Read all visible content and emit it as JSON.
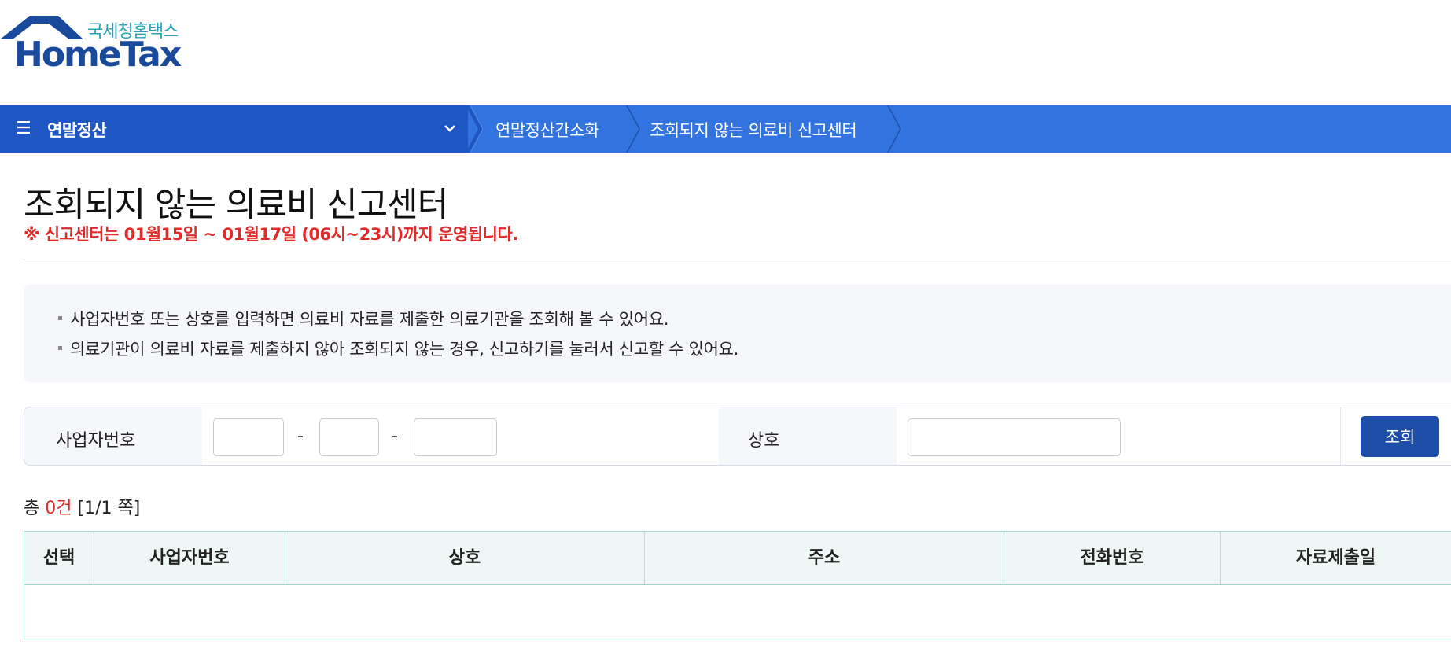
{
  "logo": {
    "korean": "국세청홈택스",
    "english": "HomeTax"
  },
  "nav": {
    "menu_label": "연말정산",
    "crumbs": [
      "연말정산간소화",
      "조회되지 않는 의료비 신고센터"
    ]
  },
  "page": {
    "title": "조회되지 않는 의료비 신고센터",
    "notice": "※ 신고센터는 01월15일 ~ 01월17일 (06시~23시)까지 운영됩니다."
  },
  "info": [
    "사업자번호 또는 상호를 입력하면 의료비 자료를 제출한 의료기관을 조회해 볼 수 있어요.",
    "의료기관이 의료비 자료를 제출하지 않아 조회되지 않는 경우, 신고하기를 눌러서 신고할 수 있어요."
  ],
  "search": {
    "bizno_label": "사업자번호",
    "bizno_part1": "",
    "bizno_part2": "",
    "bizno_part3": "",
    "dash": "-",
    "name_label": "상호",
    "name_value": "",
    "button": "조회"
  },
  "results": {
    "total_prefix": "총",
    "count": "0건",
    "page_info": "[1/1 쪽]"
  },
  "table": {
    "columns": [
      "선택",
      "사업자번호",
      "상호",
      "주소",
      "전화번호",
      "자료제출일"
    ],
    "rows": []
  },
  "colors": {
    "nav_primary": "#1e56c3",
    "nav_secondary": "#3373e0",
    "notice_red": "#e02b2b",
    "button_blue": "#1e4fa8",
    "table_header_bg": "#eef7f5"
  }
}
